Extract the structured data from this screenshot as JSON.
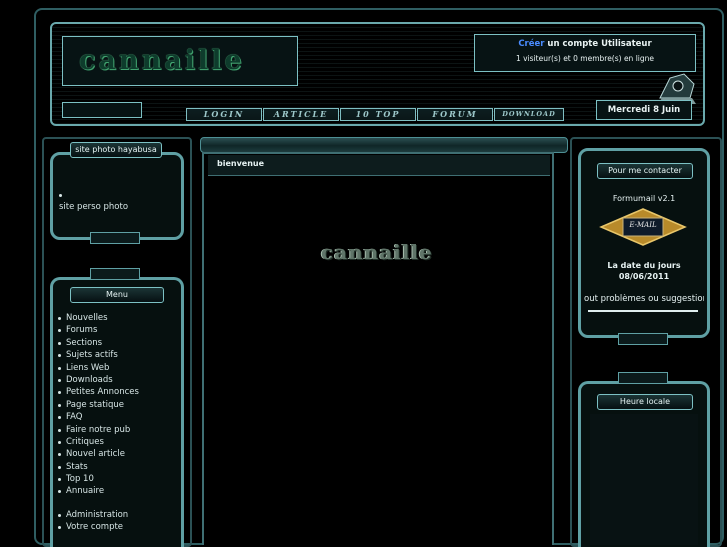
{
  "header": {
    "logo_text": "cannaille",
    "create_link": "Créer",
    "create_rest": " un compte Utilisateur",
    "visitors": "1 visiteur(s) et 0 membre(s) en ligne",
    "date": "Mercredi 8 Juin"
  },
  "nav": [
    {
      "label": "LOGIN"
    },
    {
      "label": "ARTICLE"
    },
    {
      "label": "10 TOP"
    },
    {
      "label": "FORUM"
    },
    {
      "label": "DOWNLOAD"
    }
  ],
  "left_panels": {
    "photo": {
      "title": "site photo hayabusa",
      "link": "site perso photo"
    },
    "menu": {
      "title": "Menu",
      "items": [
        "Nouvelles",
        "Forums",
        "Sections",
        "Sujets actifs",
        "Liens Web",
        "Downloads",
        "Petites Annonces",
        "Page statique",
        "FAQ",
        "Faire notre pub",
        "Critiques",
        "Nouvel article",
        "Stats",
        "Top 10",
        "Annuaire"
      ],
      "admin_items": [
        "Administration",
        "Votre compte"
      ]
    }
  },
  "center": {
    "tab_title": "bienvenue",
    "logo_text": "cannaille"
  },
  "right_panels": {
    "contact": {
      "title": "Pour me contacter",
      "formumail": "Formumail v2.1",
      "email_badge": "E-MAIL",
      "date_label": "La date du jours",
      "date_value": "08/06/2011",
      "marquee": "out problèmes ou suggestions, m"
    },
    "clock": {
      "title": "Heure locale"
    }
  },
  "colors": {
    "accent": "#5fa0a4",
    "link_blue": "#4a8cff",
    "background": "#000000"
  }
}
